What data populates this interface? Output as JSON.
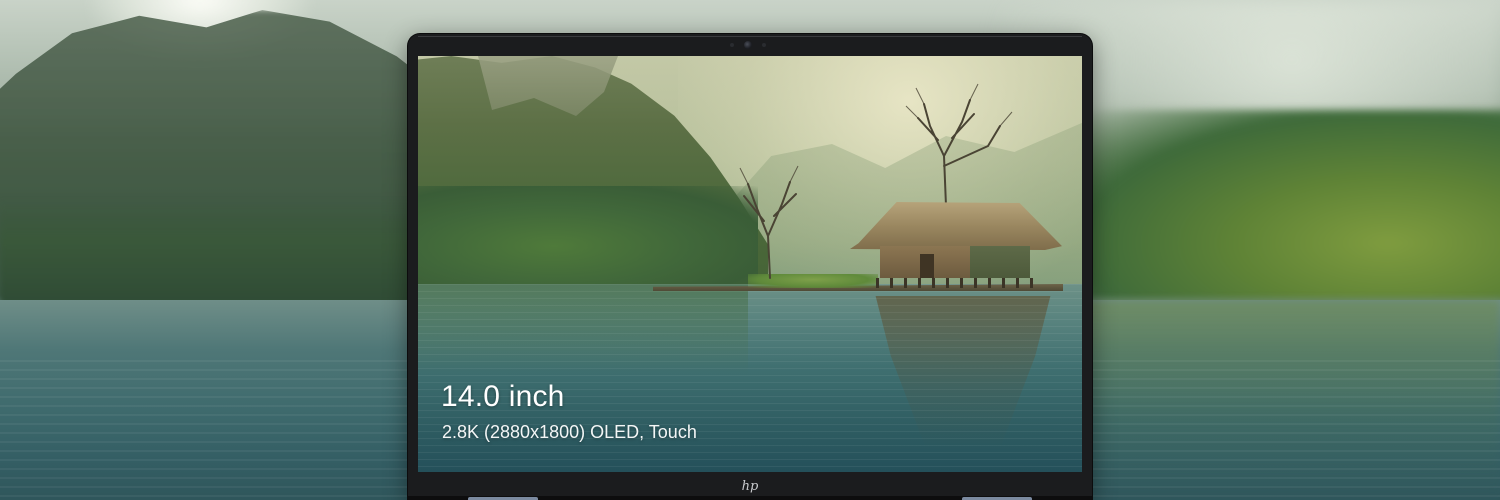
{
  "screen": {
    "title": "14.0 inch",
    "subtitle": "2.8K (2880x1800) OLED, Touch"
  },
  "brand": {
    "logo_text": "hp"
  },
  "colors": {
    "laptop_body": "#1b1c1e",
    "text": "#ffffff"
  }
}
